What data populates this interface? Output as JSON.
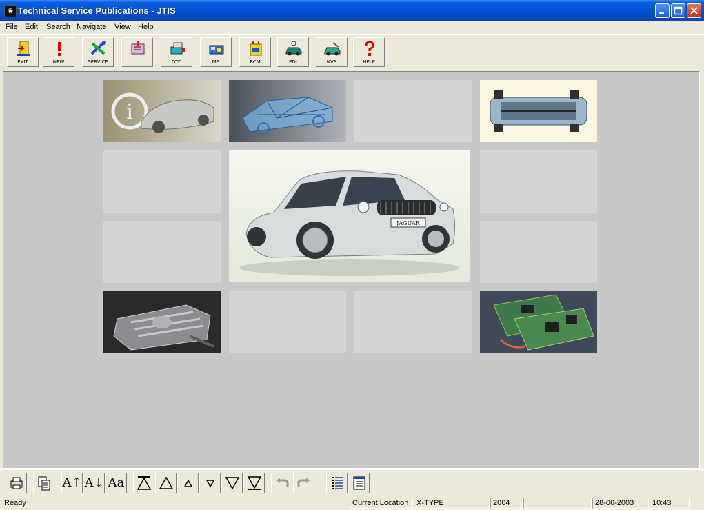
{
  "window": {
    "title": "Technical Service Publications - JTIS"
  },
  "menu": [
    "File",
    "Edit",
    "Search",
    "Navigate",
    "View",
    "Help"
  ],
  "toolbar": [
    {
      "label": "EXIT",
      "icon": "exit-door-icon"
    },
    {
      "label": "NEW",
      "icon": "exclamation-icon"
    },
    {
      "label": "SERVICE",
      "icon": "service-tools-icon"
    },
    {
      "label": "",
      "icon": "filter-icon"
    },
    {
      "label": "DTC",
      "icon": "dtc-icon"
    },
    {
      "label": "MS",
      "icon": "ms-icon"
    },
    {
      "label": "BCM",
      "icon": "bcm-icon"
    },
    {
      "label": "PDI",
      "icon": "pdi-car-icon"
    },
    {
      "label": "NVS",
      "icon": "nvs-car-icon"
    },
    {
      "label": "HELP",
      "icon": "help-question-icon"
    }
  ],
  "tiles": {
    "info": "info-car-image",
    "body": "body-shell-image",
    "chassis": "chassis-image",
    "featured": "jaguar-x-type-image",
    "engine": "engine-image",
    "electronics": "circuit-board-image",
    "featured_plate_text": "JAGUAR"
  },
  "bottom_toolbar": [
    {
      "text": "",
      "icon": "print-icon"
    },
    {
      "text": "",
      "icon": "copy-icon"
    },
    {
      "text": "A↑",
      "icon": "font-increase-icon"
    },
    {
      "text": "A↓",
      "icon": "font-decrease-icon"
    },
    {
      "text": "Aa",
      "icon": "font-icon"
    },
    {
      "text": "",
      "icon": "first-icon"
    },
    {
      "text": "",
      "icon": "up-icon"
    },
    {
      "text": "",
      "icon": "up-small-icon"
    },
    {
      "text": "",
      "icon": "down-small-icon"
    },
    {
      "text": "",
      "icon": "down-icon"
    },
    {
      "text": "",
      "icon": "last-icon"
    },
    {
      "text": "",
      "icon": "back-icon"
    },
    {
      "text": "",
      "icon": "forward-icon"
    },
    {
      "text": "",
      "icon": "list-icon"
    },
    {
      "text": "",
      "icon": "document-icon"
    }
  ],
  "status": {
    "ready": "Ready",
    "location_label": "Current Location",
    "model": "X-TYPE",
    "year": "2004",
    "blank": "",
    "date": "28-06-2003",
    "time": "10:43"
  }
}
